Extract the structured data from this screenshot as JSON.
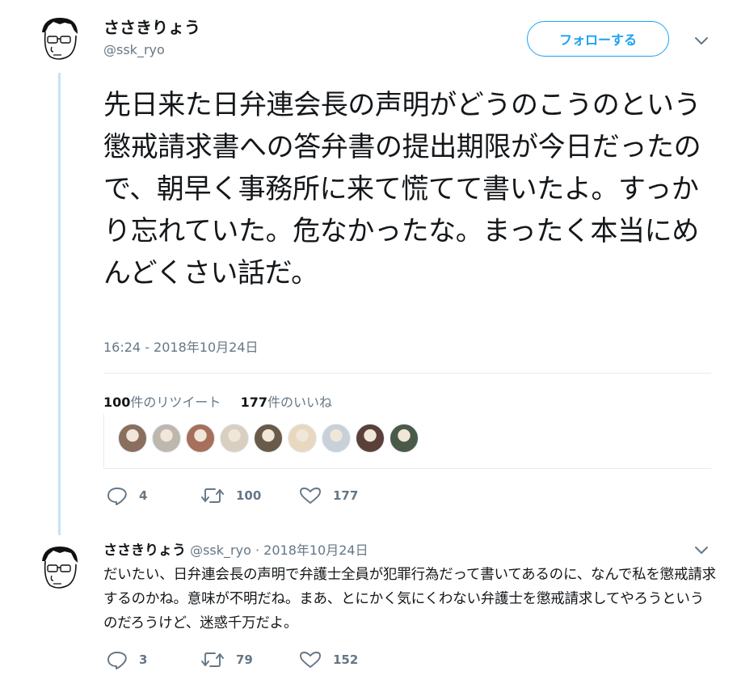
{
  "main_tweet": {
    "display_name": "ささきりょう",
    "handle": "@ssk_ryo",
    "follow_label": "フォローする",
    "text": "先日来た日弁連会長の声明がどうのこうのという懲戒請求書への答弁書の提出期限が今日だったので、朝早く事務所に来て慌てて書いたよ。すっかり忘れていた。危なかったな。まったく本当にめんどくさい話だ。",
    "timestamp": "16:24 - 2018年10月24日",
    "retweets_count": "100",
    "retweets_label": "件のリツイート",
    "likes_count": "177",
    "likes_label": "件のいいね",
    "liker_faces": [
      "#8a6f5f",
      "#bdb7ad",
      "#a6705a",
      "#d8cfc0",
      "#6a5a4a",
      "#e8d8c0",
      "#c8d0d8",
      "#5a4038",
      "#4a5a48"
    ],
    "actions": {
      "replies": "4",
      "retweets": "100",
      "likes": "177"
    }
  },
  "reply_tweet": {
    "display_name": "ささきりょう",
    "handle": "@ssk_ryo",
    "separator": "·",
    "date": "2018年10月24日",
    "text": "だいたい、日弁連会長の声明で弁護士全員が犯罪行為だって書いてあるのに、なんで私を懲戒請求するのかね。意味が不明だね。まあ、とにかく気にくわない弁護士を懲戒請求してやろうというのだろうけど、迷惑千万だよ。",
    "actions": {
      "replies": "3",
      "retweets": "79",
      "likes": "152"
    }
  },
  "colors": {
    "accent": "#1da1f2",
    "muted": "#657786",
    "thread_line": "#c4e3f8"
  },
  "icons": {
    "reply": "reply-icon",
    "retweet": "retweet-icon",
    "like": "heart-icon",
    "menu": "chevron-down-icon"
  }
}
